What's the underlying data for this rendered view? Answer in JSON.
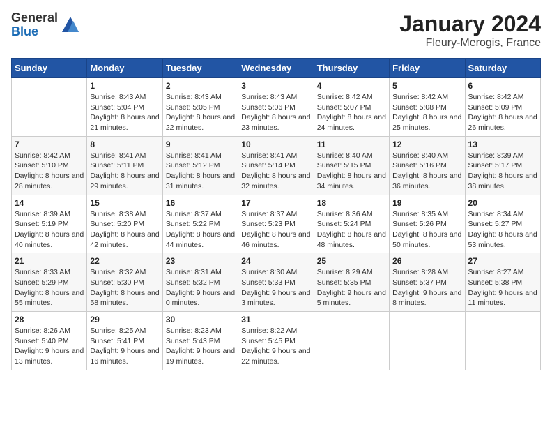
{
  "logo": {
    "general": "General",
    "blue": "Blue"
  },
  "header": {
    "month": "January 2024",
    "location": "Fleury-Merogis, France"
  },
  "weekdays": [
    "Sunday",
    "Monday",
    "Tuesday",
    "Wednesday",
    "Thursday",
    "Friday",
    "Saturday"
  ],
  "weeks": [
    [
      {
        "day": "",
        "sunrise": "",
        "sunset": "",
        "daylight": ""
      },
      {
        "day": "1",
        "sunrise": "Sunrise: 8:43 AM",
        "sunset": "Sunset: 5:04 PM",
        "daylight": "Daylight: 8 hours and 21 minutes."
      },
      {
        "day": "2",
        "sunrise": "Sunrise: 8:43 AM",
        "sunset": "Sunset: 5:05 PM",
        "daylight": "Daylight: 8 hours and 22 minutes."
      },
      {
        "day": "3",
        "sunrise": "Sunrise: 8:43 AM",
        "sunset": "Sunset: 5:06 PM",
        "daylight": "Daylight: 8 hours and 23 minutes."
      },
      {
        "day": "4",
        "sunrise": "Sunrise: 8:42 AM",
        "sunset": "Sunset: 5:07 PM",
        "daylight": "Daylight: 8 hours and 24 minutes."
      },
      {
        "day": "5",
        "sunrise": "Sunrise: 8:42 AM",
        "sunset": "Sunset: 5:08 PM",
        "daylight": "Daylight: 8 hours and 25 minutes."
      },
      {
        "day": "6",
        "sunrise": "Sunrise: 8:42 AM",
        "sunset": "Sunset: 5:09 PM",
        "daylight": "Daylight: 8 hours and 26 minutes."
      }
    ],
    [
      {
        "day": "7",
        "sunrise": "Sunrise: 8:42 AM",
        "sunset": "Sunset: 5:10 PM",
        "daylight": "Daylight: 8 hours and 28 minutes."
      },
      {
        "day": "8",
        "sunrise": "Sunrise: 8:41 AM",
        "sunset": "Sunset: 5:11 PM",
        "daylight": "Daylight: 8 hours and 29 minutes."
      },
      {
        "day": "9",
        "sunrise": "Sunrise: 8:41 AM",
        "sunset": "Sunset: 5:12 PM",
        "daylight": "Daylight: 8 hours and 31 minutes."
      },
      {
        "day": "10",
        "sunrise": "Sunrise: 8:41 AM",
        "sunset": "Sunset: 5:14 PM",
        "daylight": "Daylight: 8 hours and 32 minutes."
      },
      {
        "day": "11",
        "sunrise": "Sunrise: 8:40 AM",
        "sunset": "Sunset: 5:15 PM",
        "daylight": "Daylight: 8 hours and 34 minutes."
      },
      {
        "day": "12",
        "sunrise": "Sunrise: 8:40 AM",
        "sunset": "Sunset: 5:16 PM",
        "daylight": "Daylight: 8 hours and 36 minutes."
      },
      {
        "day": "13",
        "sunrise": "Sunrise: 8:39 AM",
        "sunset": "Sunset: 5:17 PM",
        "daylight": "Daylight: 8 hours and 38 minutes."
      }
    ],
    [
      {
        "day": "14",
        "sunrise": "Sunrise: 8:39 AM",
        "sunset": "Sunset: 5:19 PM",
        "daylight": "Daylight: 8 hours and 40 minutes."
      },
      {
        "day": "15",
        "sunrise": "Sunrise: 8:38 AM",
        "sunset": "Sunset: 5:20 PM",
        "daylight": "Daylight: 8 hours and 42 minutes."
      },
      {
        "day": "16",
        "sunrise": "Sunrise: 8:37 AM",
        "sunset": "Sunset: 5:22 PM",
        "daylight": "Daylight: 8 hours and 44 minutes."
      },
      {
        "day": "17",
        "sunrise": "Sunrise: 8:37 AM",
        "sunset": "Sunset: 5:23 PM",
        "daylight": "Daylight: 8 hours and 46 minutes."
      },
      {
        "day": "18",
        "sunrise": "Sunrise: 8:36 AM",
        "sunset": "Sunset: 5:24 PM",
        "daylight": "Daylight: 8 hours and 48 minutes."
      },
      {
        "day": "19",
        "sunrise": "Sunrise: 8:35 AM",
        "sunset": "Sunset: 5:26 PM",
        "daylight": "Daylight: 8 hours and 50 minutes."
      },
      {
        "day": "20",
        "sunrise": "Sunrise: 8:34 AM",
        "sunset": "Sunset: 5:27 PM",
        "daylight": "Daylight: 8 hours and 53 minutes."
      }
    ],
    [
      {
        "day": "21",
        "sunrise": "Sunrise: 8:33 AM",
        "sunset": "Sunset: 5:29 PM",
        "daylight": "Daylight: 8 hours and 55 minutes."
      },
      {
        "day": "22",
        "sunrise": "Sunrise: 8:32 AM",
        "sunset": "Sunset: 5:30 PM",
        "daylight": "Daylight: 8 hours and 58 minutes."
      },
      {
        "day": "23",
        "sunrise": "Sunrise: 8:31 AM",
        "sunset": "Sunset: 5:32 PM",
        "daylight": "Daylight: 9 hours and 0 minutes."
      },
      {
        "day": "24",
        "sunrise": "Sunrise: 8:30 AM",
        "sunset": "Sunset: 5:33 PM",
        "daylight": "Daylight: 9 hours and 3 minutes."
      },
      {
        "day": "25",
        "sunrise": "Sunrise: 8:29 AM",
        "sunset": "Sunset: 5:35 PM",
        "daylight": "Daylight: 9 hours and 5 minutes."
      },
      {
        "day": "26",
        "sunrise": "Sunrise: 8:28 AM",
        "sunset": "Sunset: 5:37 PM",
        "daylight": "Daylight: 9 hours and 8 minutes."
      },
      {
        "day": "27",
        "sunrise": "Sunrise: 8:27 AM",
        "sunset": "Sunset: 5:38 PM",
        "daylight": "Daylight: 9 hours and 11 minutes."
      }
    ],
    [
      {
        "day": "28",
        "sunrise": "Sunrise: 8:26 AM",
        "sunset": "Sunset: 5:40 PM",
        "daylight": "Daylight: 9 hours and 13 minutes."
      },
      {
        "day": "29",
        "sunrise": "Sunrise: 8:25 AM",
        "sunset": "Sunset: 5:41 PM",
        "daylight": "Daylight: 9 hours and 16 minutes."
      },
      {
        "day": "30",
        "sunrise": "Sunrise: 8:23 AM",
        "sunset": "Sunset: 5:43 PM",
        "daylight": "Daylight: 9 hours and 19 minutes."
      },
      {
        "day": "31",
        "sunrise": "Sunrise: 8:22 AM",
        "sunset": "Sunset: 5:45 PM",
        "daylight": "Daylight: 9 hours and 22 minutes."
      },
      {
        "day": "",
        "sunrise": "",
        "sunset": "",
        "daylight": ""
      },
      {
        "day": "",
        "sunrise": "",
        "sunset": "",
        "daylight": ""
      },
      {
        "day": "",
        "sunrise": "",
        "sunset": "",
        "daylight": ""
      }
    ]
  ]
}
